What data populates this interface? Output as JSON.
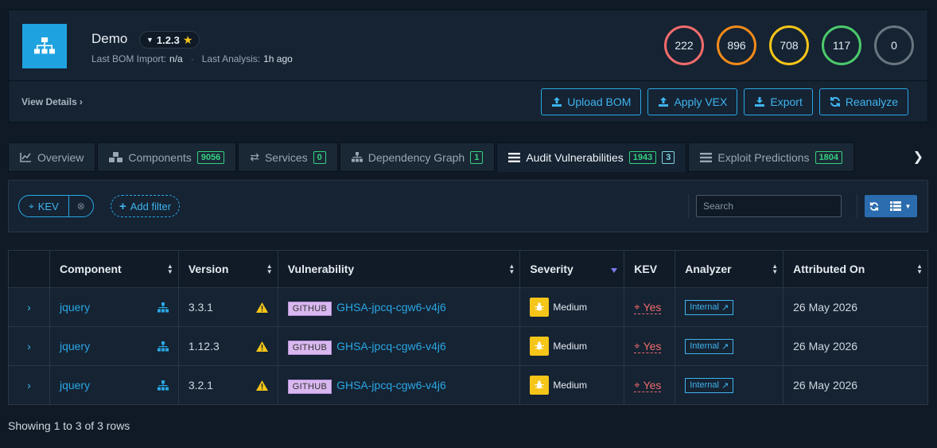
{
  "project": {
    "name": "Demo",
    "version": "1.2.3",
    "last_bom_import_label": "Last BOM Import:",
    "last_bom_import_value": "n/a",
    "last_analysis_label": "Last Analysis:",
    "last_analysis_value": "1h ago"
  },
  "risk": [
    {
      "value": "222",
      "color": "#f26b6b"
    },
    {
      "value": "896",
      "color": "#f28a1a"
    },
    {
      "value": "708",
      "color": "#f5c518"
    },
    {
      "value": "117",
      "color": "#4cc96b"
    },
    {
      "value": "0",
      "color": "#6b7580"
    }
  ],
  "header": {
    "view_details": "View Details",
    "upload_bom": "Upload BOM",
    "apply_vex": "Apply VEX",
    "export": "Export",
    "reanalyze": "Reanalyze"
  },
  "tabs": [
    {
      "label": "Overview",
      "badge": "",
      "badge2": ""
    },
    {
      "label": "Components",
      "badge": "9056",
      "badge2": ""
    },
    {
      "label": "Services",
      "badge": "0",
      "badge2": ""
    },
    {
      "label": "Dependency Graph",
      "badge": "1",
      "badge2": ""
    },
    {
      "label": "Audit Vulnerabilities",
      "badge": "1943",
      "badge2": "3"
    },
    {
      "label": "Exploit Predictions",
      "badge": "1804",
      "badge2": ""
    }
  ],
  "toolbar": {
    "filter_kev": "KEV",
    "add_filter": "Add filter",
    "search_placeholder": "Search"
  },
  "table": {
    "headers": {
      "component": "Component",
      "version": "Version",
      "vulnerability": "Vulnerability",
      "severity": "Severity",
      "kev": "KEV",
      "analyzer": "Analyzer",
      "attributed_on": "Attributed On"
    },
    "rows": [
      {
        "component": "jquery",
        "version": "3.3.1",
        "source": "GITHUB",
        "vuln_id": "GHSA-jpcq-cgw6-v4j6",
        "severity": "Medium",
        "kev": "Yes",
        "analyzer": "Internal",
        "attributed_on": "26 May 2026"
      },
      {
        "component": "jquery",
        "version": "1.12.3",
        "source": "GITHUB",
        "vuln_id": "GHSA-jpcq-cgw6-v4j6",
        "severity": "Medium",
        "kev": "Yes",
        "analyzer": "Internal",
        "attributed_on": "26 May 2026"
      },
      {
        "component": "jquery",
        "version": "3.2.1",
        "source": "GITHUB",
        "vuln_id": "GHSA-jpcq-cgw6-v4j6",
        "severity": "Medium",
        "kev": "Yes",
        "analyzer": "Internal",
        "attributed_on": "26 May 2026"
      }
    ]
  },
  "footer": {
    "showing": "Showing 1 to 3 of 3 rows"
  }
}
